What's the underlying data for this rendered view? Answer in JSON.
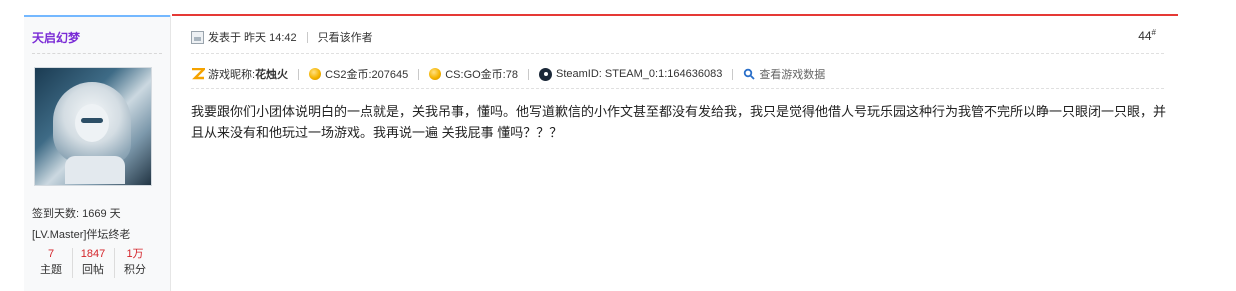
{
  "user": {
    "name": "天启幻梦",
    "checkin": "签到天数: 1669 天",
    "level": "[LV.Master]伴坛终老",
    "stats": [
      {
        "value": "7",
        "label": "主题"
      },
      {
        "value": "1847",
        "label": "回帖"
      },
      {
        "value": "1万",
        "label": "积分"
      }
    ]
  },
  "post": {
    "posted": "发表于 昨天 14:42",
    "only_author": "只看该作者",
    "floor": "44",
    "floor_mark": "#",
    "game_nick_label": "游戏昵称:",
    "game_nick": "花烛火",
    "cs2_coins": "CS2金币:207645",
    "csgo_coins": "CS:GO金币:78",
    "steam_id": "SteamID: STEAM_0:1:164636083",
    "view_game_data": "查看游戏数据",
    "content": "我要跟你们小团体说明白的一点就是，关我吊事，懂吗。他写道歉信的小作文甚至都没有发给我，我只是觉得他借人号玩乐园这种行为我管不完所以睁一只眼闭一只眼，并且从来没有和他玩过一场游戏。我再说一遍 关我屁事 懂吗？？？"
  },
  "colors": {
    "accent_red": "#e53935",
    "side_top": "#74b8ff",
    "username": "#7a2bd6",
    "count_red": "#d4242a"
  },
  "icons": [
    "post-icon",
    "z-game-icon",
    "coin-icon",
    "steam-icon",
    "search-icon"
  ]
}
